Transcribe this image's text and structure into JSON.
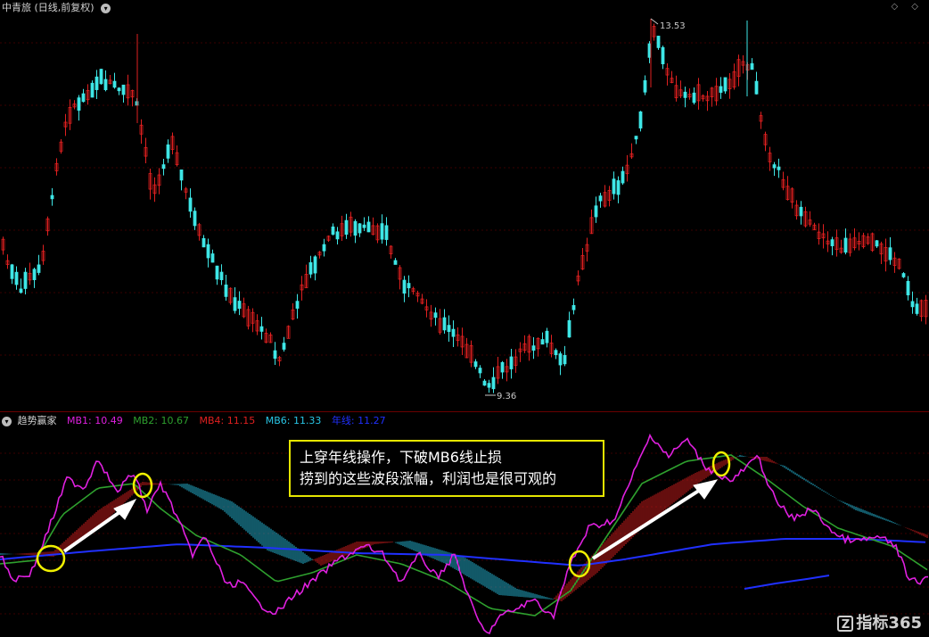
{
  "header": {
    "title": "中青旅 (日线,前复权)",
    "window_controls": "◇ ◇"
  },
  "price_chart": {
    "high_label": "13.53",
    "low_label": "9.36"
  },
  "indicator": {
    "name": "趋势赢家",
    "mb1": {
      "label": "MB1: 10.49",
      "color": "#e020e0"
    },
    "mb2": {
      "label": "MB2: 10.67",
      "color": "#2ea02e"
    },
    "mb4": {
      "label": "MB4: 11.15",
      "color": "#e02020"
    },
    "mb6": {
      "label": "MB6: 11.33",
      "color": "#29c6e6"
    },
    "year_line": {
      "label": "年线: 11.27",
      "color": "#2030ff"
    }
  },
  "annotation": {
    "line1": "上穿年线操作，下破MB6线止损",
    "line2": "捞到的这些波段涨幅，利润也是很可观的"
  },
  "brand": {
    "text": "指标365"
  },
  "colors": {
    "up_candle": "#e02020",
    "down_candle": "#3ee6e6",
    "highlight_circle": "#f0f000",
    "arrow": "#ffffff"
  }
}
